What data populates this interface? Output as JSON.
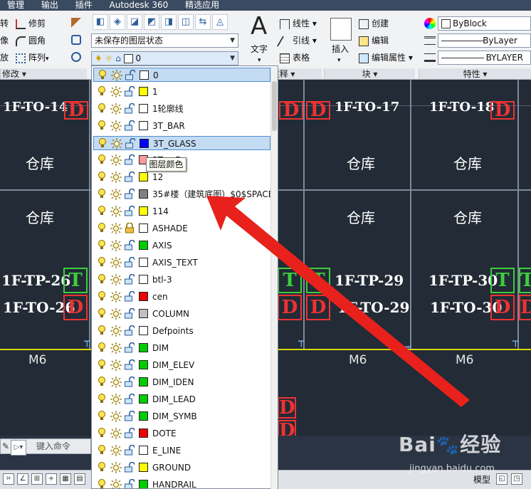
{
  "menubar": {
    "items": [
      "管理",
      "输出",
      "插件",
      "Autodesk 360",
      "精选应用"
    ]
  },
  "ribbon": {
    "modify": {
      "rotate": "转",
      "trim": "修剪",
      "mirror": "像",
      "fillet": "圆角",
      "stretch": "放",
      "array": "阵列",
      "title": "修改"
    },
    "layers": {
      "state": "未保存的图层状态",
      "current_layer": "0"
    },
    "annotation": {
      "text": "文字",
      "linear": "线性",
      "leader": "引线",
      "table": "表格",
      "title": "注释"
    },
    "block": {
      "insert": "插入",
      "create": "创建",
      "edit": "编辑",
      "edit_attr": "编辑属性",
      "title": "块"
    },
    "properties": {
      "color": "ByBlock",
      "linetype": "ByLayer",
      "lineweight": "BYLAYER",
      "title": "特性"
    }
  },
  "drawing": {
    "labels": [
      "1F-TO-14",
      "1F-TO-17",
      "1F-TO-18",
      "仓库",
      "仓库",
      "仓库",
      "仓库",
      "仓库",
      "仓库",
      "1F-TP-26",
      "1F-TO-26",
      "1F-TP-29",
      "1F-TO-29",
      "1F-TP-30",
      "1F-TO-30",
      "M6",
      "M6",
      "M6"
    ],
    "t": "T",
    "d": "D"
  },
  "command": {
    "placeholder": "键入命令"
  },
  "statusbar": {
    "model": "模型"
  },
  "layer_dropdown": {
    "rows": [
      {
        "name": "0",
        "color": "#ffffff",
        "selected": true
      },
      {
        "name": "1",
        "color": "#ffff00"
      },
      {
        "name": "1轮廓线",
        "color": "#ffffff"
      },
      {
        "name": "3T_BAR",
        "color": "#ffffff"
      },
      {
        "name": "3T_GLASS",
        "color": "#0000ff",
        "selected": true
      },
      {
        "name": "3T_...D",
        "color": "#ff9999"
      },
      {
        "name": "12",
        "color": "#ffff00"
      },
      {
        "name": "35#楼（建筑底图）$0$SPACE",
        "color": "#808080"
      },
      {
        "name": "114",
        "color": "#ffff00"
      },
      {
        "name": "ASHADE",
        "color": "#ffffff",
        "locked": true
      },
      {
        "name": "AXIS",
        "color": "#00cc00"
      },
      {
        "name": "AXIS_TEXT",
        "color": "#ffffff"
      },
      {
        "name": "btl-3",
        "color": "#ffffff"
      },
      {
        "name": "cen",
        "color": "#ee0000"
      },
      {
        "name": "COLUMN",
        "color": "#c0c0c0"
      },
      {
        "name": "Defpoints",
        "color": "#ffffff"
      },
      {
        "name": "DIM",
        "color": "#00cc00"
      },
      {
        "name": "DIM_ELEV",
        "color": "#00cc00"
      },
      {
        "name": "DIM_IDEN",
        "color": "#00cc00"
      },
      {
        "name": "DIM_LEAD",
        "color": "#00cc00"
      },
      {
        "name": "DIM_SYMB",
        "color": "#00cc00"
      },
      {
        "name": "DOTE",
        "color": "#ee0000"
      },
      {
        "name": "E_LINE",
        "color": "#ffffff"
      },
      {
        "name": "GROUND",
        "color": "#ffff00"
      },
      {
        "name": "HANDRAIL",
        "color": "#00cc00"
      }
    ]
  },
  "tooltip": {
    "text": "图层颜色"
  },
  "watermark": {
    "brand": "Bai",
    "brand2": "经验",
    "url": "jingyan.baidu.com"
  },
  "colors": {
    "accent": "#e8211c",
    "selection": "#c4dbf4",
    "canvas": "#222b36"
  }
}
